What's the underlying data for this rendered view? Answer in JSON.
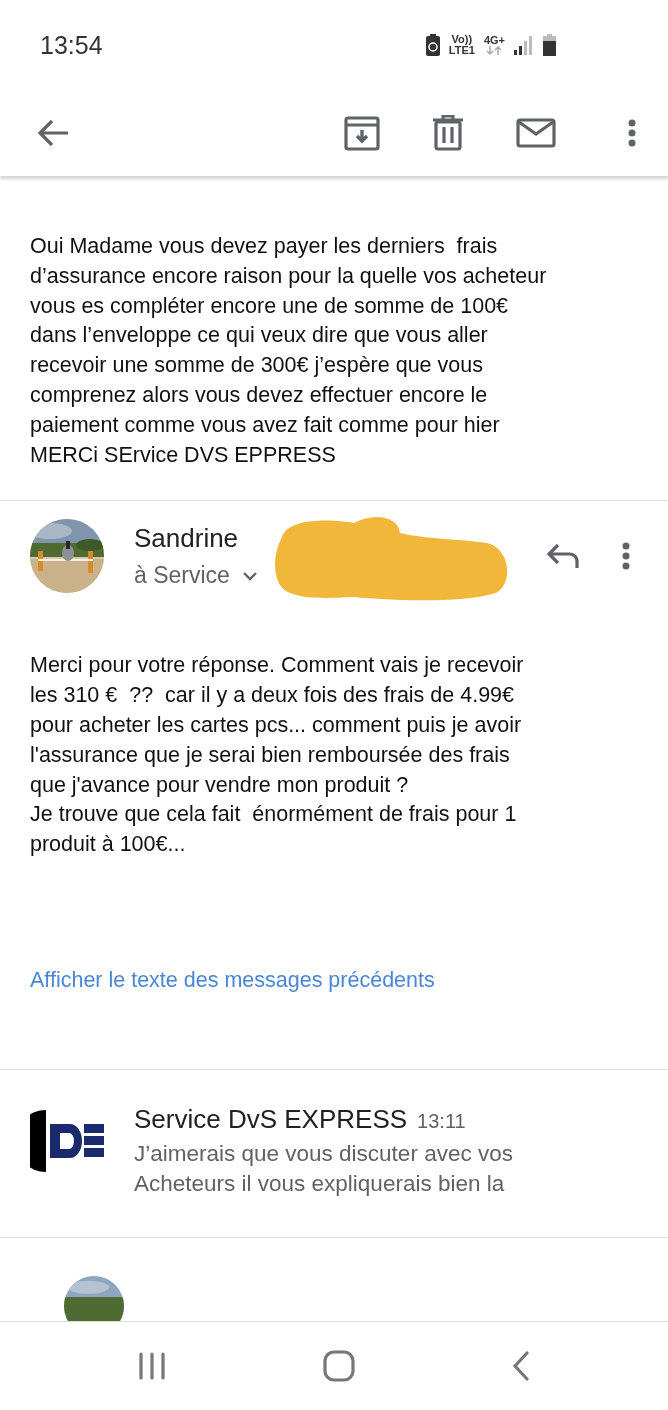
{
  "status_bar": {
    "time": "13:54",
    "network_texts": [
      "Vo))",
      "LTE1",
      "4G+"
    ]
  },
  "messages": [
    {
      "kind": "body",
      "text": "Oui Madame vous devez payer les derniers  frais\nd’assurance encore raison pour la quelle vos acheteur\nvous es compléter encore une de somme de 100€\ndans l’enveloppe ce qui veux dire que vous aller\nrecevoir une somme de 300€ j’espère que vous\ncomprenez alors vous devez effectuer encore le\npaiement comme vous avez fait comme pour hier\nMERCi SErvice DVS EPPRESS"
    },
    {
      "kind": "expanded",
      "sender": "Sandrine",
      "recipient": "à Service",
      "redacted": true,
      "text": "Merci pour votre réponse. Comment vais je recevoir\nles 310 €  ??  car il y a deux fois des frais de 4.99€\npour acheter les cartes pcs... comment puis je avoir\nl'assurance que je serai bien remboursée des frais\nque j'avance pour vendre mon produit ?\nJe trouve que cela fait  énormément de frais pour 1\nproduit à 100€...",
      "link": "Afficher le texte des messages précédents"
    },
    {
      "kind": "collapsed",
      "sender": "Service DvS EXPRESS",
      "time": "13:11",
      "snippet": "J’aimerais que vous discuter avec vos\nAcheteurs il vous expliquerais bien la"
    },
    {
      "kind": "cut"
    }
  ]
}
